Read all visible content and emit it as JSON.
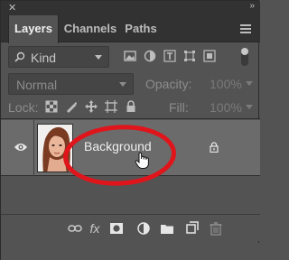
{
  "panel": {
    "tabs": [
      {
        "label": "Layers",
        "active": true
      },
      {
        "label": "Channels",
        "active": false
      },
      {
        "label": "Paths",
        "active": false
      }
    ]
  },
  "filter": {
    "kind_label": "Kind",
    "icons": [
      "image-filter-icon",
      "adjustment-filter-icon",
      "type-filter-icon",
      "shape-filter-icon",
      "smart-object-filter-icon"
    ]
  },
  "blend": {
    "mode": "Normal",
    "opacity_label": "Opacity:",
    "opacity_value": "100%"
  },
  "lock": {
    "label": "Lock:",
    "icons": [
      "lock-transparent-icon",
      "lock-image-icon",
      "lock-position-icon",
      "lock-artboard-icon",
      "lock-all-icon"
    ],
    "fill_label": "Fill:",
    "fill_value": "100%"
  },
  "layers": [
    {
      "name": "Background",
      "visible": true,
      "locked": true
    }
  ],
  "annotation_color": "#e0141b",
  "bottom_icons": [
    "link-icon",
    "fx-icon",
    "mask-icon",
    "adjustment-icon",
    "group-icon",
    "new-layer-icon",
    "delete-icon"
  ],
  "labels": {
    "fx": "fx"
  }
}
